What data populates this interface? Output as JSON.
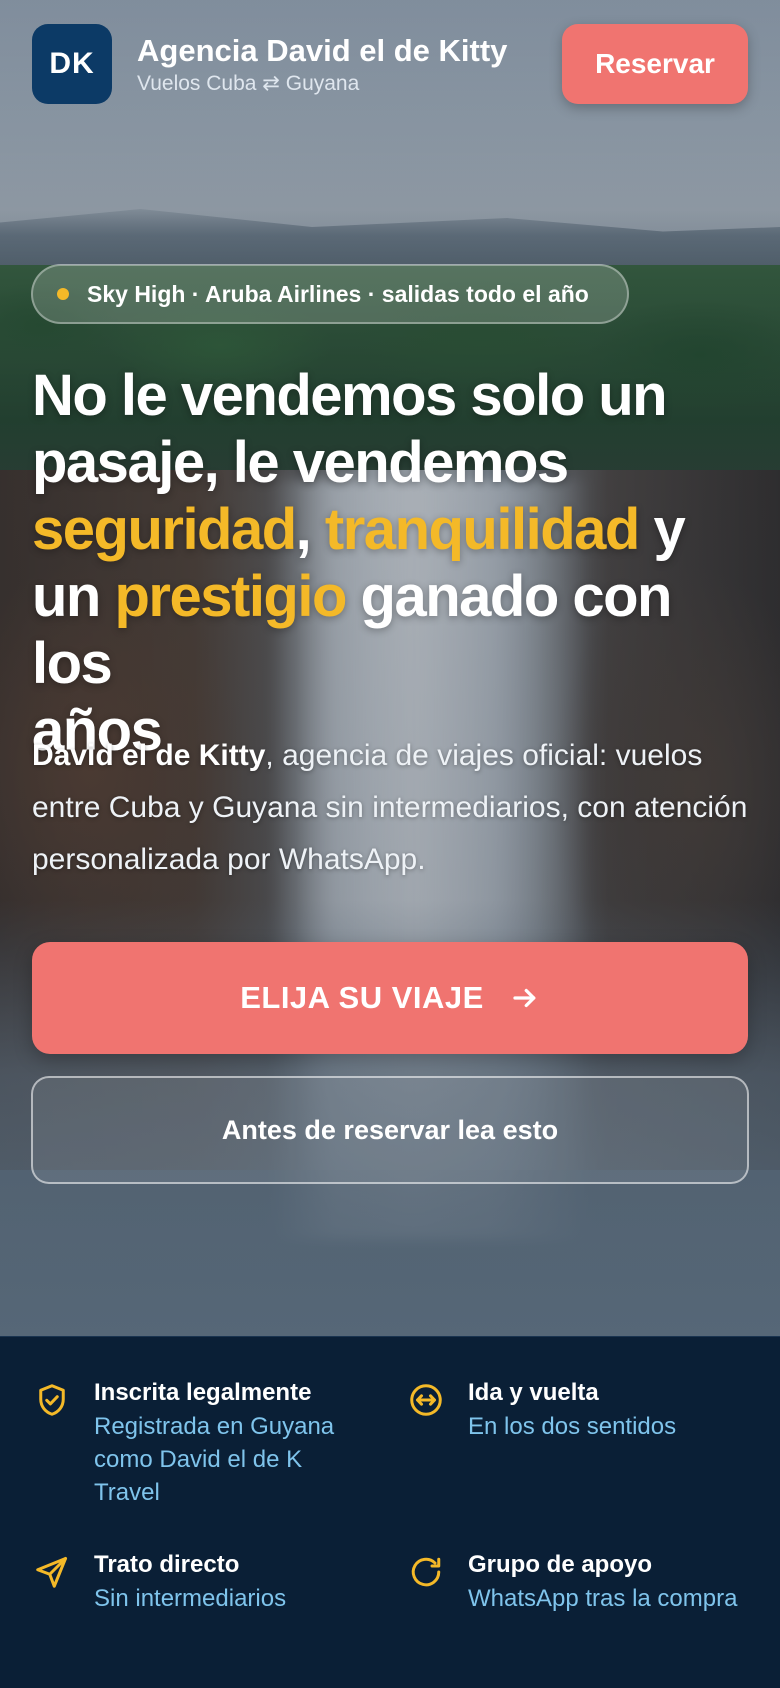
{
  "header": {
    "logo_text": "DK",
    "brand_name": "Agencia David el de Kitty",
    "brand_subtitle": "Vuelos Cuba ⇄ Guyana",
    "reserve_label": "Reservar"
  },
  "hero": {
    "pill_text": "Sky High · Aruba Airlines · salidas todo el año",
    "headline": {
      "l1": "No le vendemos solo un",
      "l2": "pasaje, le vendemos",
      "hl1": "seguridad",
      "comma": ",",
      "hl2": "tranquilidad",
      "y": "y",
      "un": "un",
      "hl3": "prestigio",
      "l4_rest": "ganado con los",
      "l5": "años"
    },
    "intro_bold": "David el de Kitty",
    "intro_rest": ", agencia de viajes oficial: vuelos entre Cuba y Guyana sin intermediarios, con atención personalizada por WhatsApp.",
    "cta_label": "ELIJA SU VIAJE",
    "secondary_label": "Antes de reservar lea esto"
  },
  "features": [
    {
      "icon": "shield-check-icon",
      "title": "Inscrita legalmente",
      "desc": "Registrada en Guyana como David el de K Travel"
    },
    {
      "icon": "round-trip-icon",
      "title": "Ida y vuelta",
      "desc": "En los dos sentidos"
    },
    {
      "icon": "send-icon",
      "title": "Trato directo",
      "desc": "Sin intermediarios"
    },
    {
      "icon": "refresh-icon",
      "title": "Grupo de apoyo",
      "desc": "WhatsApp tras la compra"
    }
  ],
  "colors": {
    "accent": "#f07470",
    "highlight": "#f4b928",
    "logo_bg": "#0c3a66",
    "feature_bg": "#0a1f36",
    "feature_desc": "#7fc4ec"
  }
}
